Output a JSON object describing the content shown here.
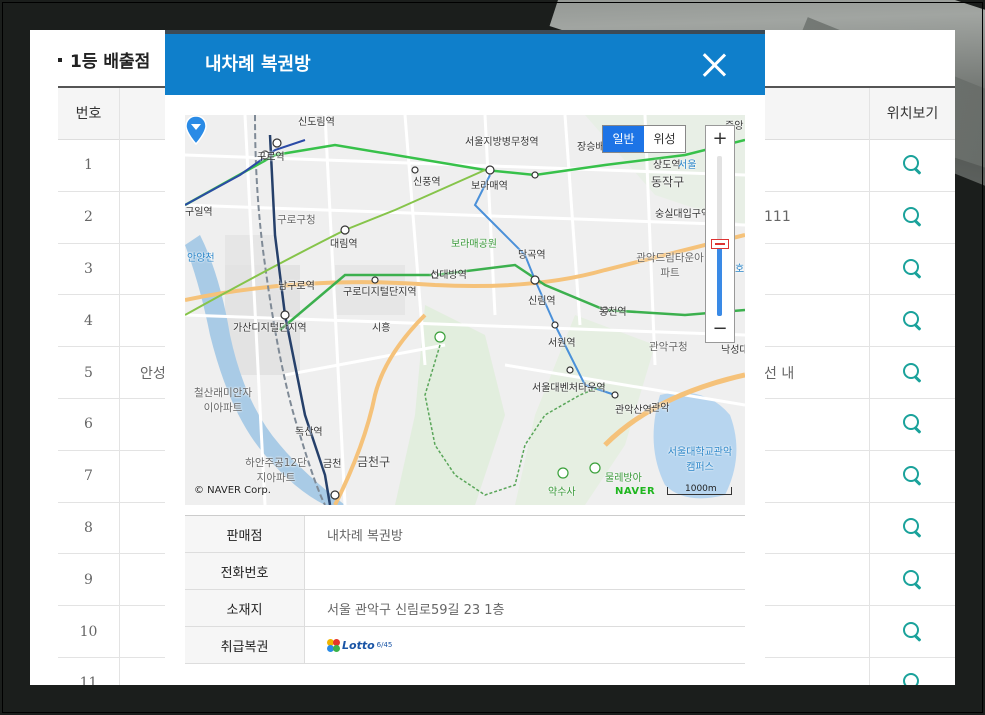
{
  "page": {
    "section_title": "1등 배출점",
    "table": {
      "header_no": "번호",
      "header_location": "위치보기",
      "rows": [
        {
          "no": "1",
          "name": "",
          "addr": ""
        },
        {
          "no": "2",
          "name": "",
          "addr": "111"
        },
        {
          "no": "3",
          "name": "",
          "addr": ""
        },
        {
          "no": "4",
          "name": "",
          "addr": ""
        },
        {
          "no": "5",
          "name": "안성",
          "addr": "선 내"
        },
        {
          "no": "6",
          "name": "",
          "addr": ""
        },
        {
          "no": "7",
          "name": "",
          "addr": ""
        },
        {
          "no": "8",
          "name": "",
          "addr": ""
        },
        {
          "no": "9",
          "name": "",
          "addr": ""
        },
        {
          "no": "10",
          "name": "",
          "addr": ""
        },
        {
          "no": "11",
          "name": "",
          "addr": ""
        }
      ]
    }
  },
  "modal": {
    "title": "내차례 복권방",
    "map": {
      "type_normal": "일반",
      "type_satellite": "위성",
      "zoom_in": "+",
      "zoom_out": "−",
      "zoom_level": 0.45,
      "copyright": "© NAVER Corp.",
      "brand": "NAVER",
      "scale": "1000m",
      "labels": {
        "l1": "신도림역",
        "l2": "구로역",
        "l3": "서울지방병무청역",
        "l4": "장승배",
        "l5": "상도역",
        "l6": "신풍역",
        "l7": "보라매역",
        "l8": "동작구",
        "l9": "숭실대입구역",
        "l10": "구로구청",
        "l11": "대림역",
        "l12": "보라매공원",
        "l13": "당곡역",
        "l14": "안양천",
        "l15": "관악드림타운아파트",
        "l16": "남구로역",
        "l17": "신대방역",
        "l18": "구로디지털단지역",
        "l19": "신림역",
        "l20": "가산디지털단지역",
        "l21": "시흥",
        "l22": "봉천역",
        "l23": "관악구청",
        "l24": "서원역",
        "l25": "철산래미안자이아파트",
        "l26": "서울대벤처타운역",
        "l27": "관악산역",
        "l28": "관악",
        "l29": "독산역",
        "l30": "서울대학교관악캠퍼스",
        "l31": "하안주공12단지아파트",
        "l32": "금천",
        "l33": "금천구",
        "l34": "물레방아",
        "l35": "약수사",
        "l36": "낙성대",
        "l37": "구일역",
        "l38": "서울",
        "l39": "중앙",
        "l40": "호"
      }
    },
    "info": {
      "store_label": "판매점",
      "store_value": "내차례 복권방",
      "phone_label": "전화번호",
      "phone_value": "",
      "address_label": "소재지",
      "address_value": "서울 관악구 신림로59길 23 1층",
      "products_label": "취급복권",
      "products_logo_text": "Lotto",
      "products_logo_sub": "6/45"
    }
  },
  "colors": {
    "header_blue": "#0f7fcb",
    "search_icon_teal": "#1aa29b",
    "map_button_blue": "#1d74e6"
  }
}
